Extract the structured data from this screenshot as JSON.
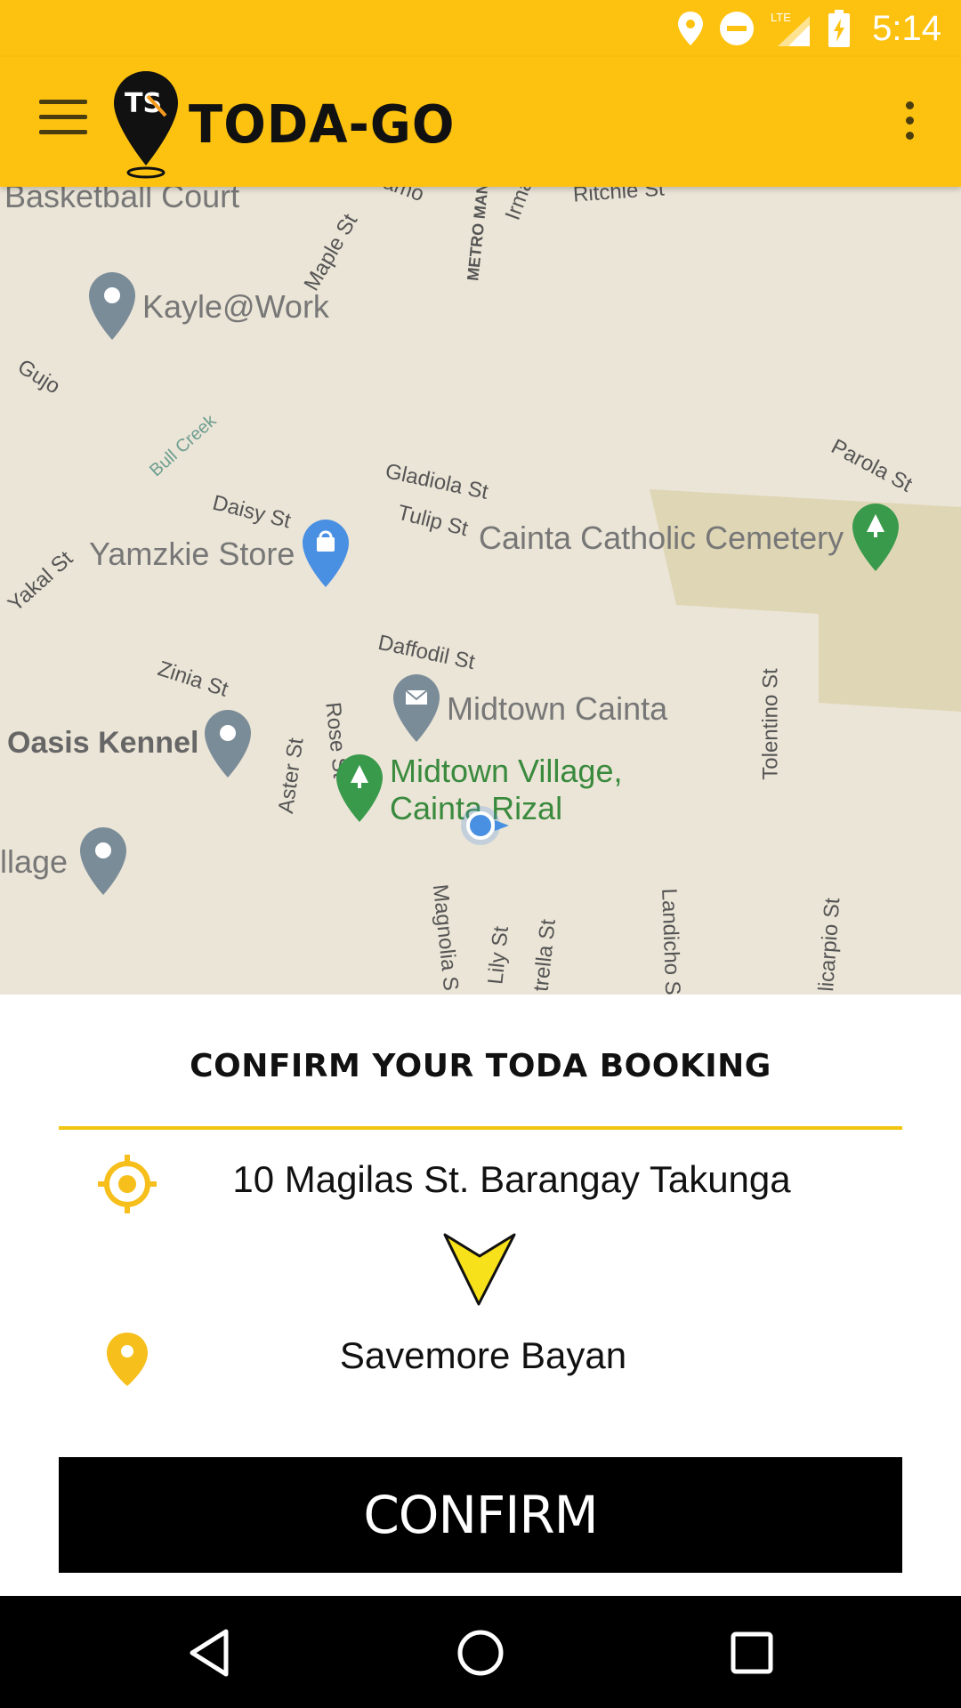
{
  "status_bar": {
    "time": "5:14",
    "network": "LTE",
    "icons": [
      "location-icon",
      "do-not-disturb-icon",
      "signal-icon",
      "battery-charging-icon"
    ]
  },
  "app_bar": {
    "title": "TODA-GO",
    "logo_monogram": "TS"
  },
  "map": {
    "poi": {
      "basketball": "Basketball Court",
      "kayle": "Kayle@Work",
      "yamzkie": "Yamzkie Store",
      "midtown_cainta": "Midtown Cainta",
      "oasis": "Oasis Kennel",
      "village_left": "llage",
      "cemetery": "Cainta Catholic Cemetery",
      "midtown_village_1": "Midtown Village,",
      "midtown_village_2": "Cainta Rizal"
    },
    "streets": {
      "ramo": "amo",
      "maple": "Maple St",
      "metro": "METRO MAN",
      "irma": "Irma",
      "ritchie": "Ritchie St",
      "gujo": "Gujo",
      "bull_creek": "Bull Creek",
      "gladiola": "Gladiola St",
      "daisy": "Daisy St",
      "tulip": "Tulip St",
      "parola": "Parola St",
      "yakal": "Yakal St",
      "daffodil": "Daffodil St",
      "zinia": "Zinia St",
      "rose": "Rose St",
      "aster": "Aster St",
      "tolentino": "Tolentino St",
      "magnolia": "Magnolia S",
      "lily": "Lily St",
      "estrella": "trella St",
      "landicho": "Landicho St",
      "policarpio": "licarpio St"
    }
  },
  "booking": {
    "title": "CONFIRM YOUR TODA BOOKING",
    "origin": "10 Magilas St. Barangay Takunga",
    "destination": "Savemore Bayan",
    "confirm_label": "CONFIRM"
  },
  "colors": {
    "brand_yellow": "#fdc210",
    "accent": "#f0c40f",
    "button": "#000000"
  }
}
